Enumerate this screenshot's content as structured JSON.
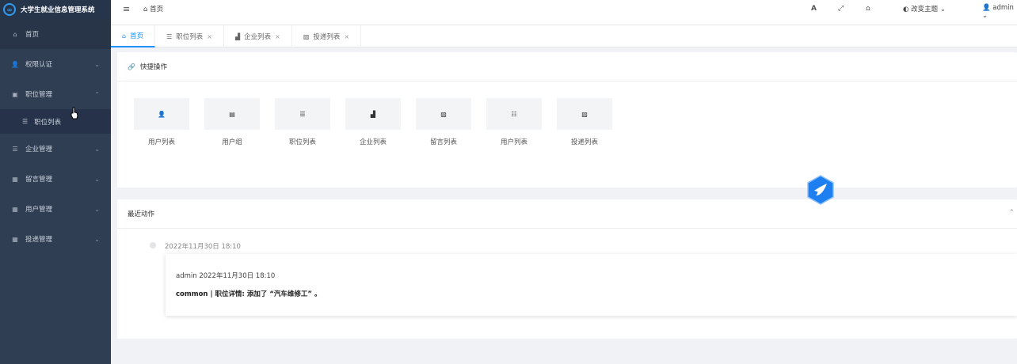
{
  "app": {
    "title": "大学生就业信息管理系统"
  },
  "sidebar": {
    "items": [
      {
        "label": "首页",
        "icon": "home-icon"
      },
      {
        "label": "权限认证",
        "icon": "user-shield-icon"
      },
      {
        "label": "职位管理",
        "icon": "briefcase-icon"
      },
      {
        "label": "企业管理",
        "icon": "list-icon"
      },
      {
        "label": "留言管理",
        "icon": "grid-icon"
      },
      {
        "label": "用户管理",
        "icon": "grid-icon"
      },
      {
        "label": "投递管理",
        "icon": "grid-icon"
      }
    ],
    "submenu": {
      "label": "职位列表",
      "icon": "list-icon"
    }
  },
  "topbar": {
    "breadcrumb": "首页",
    "theme_label": "改变主题",
    "user_label": "admin"
  },
  "tabs": [
    {
      "label": "首页"
    },
    {
      "label": "职位列表"
    },
    {
      "label": "企业列表"
    },
    {
      "label": "投递列表"
    }
  ],
  "quick": {
    "title": "快捷操作",
    "items": [
      {
        "label": "用户列表",
        "icon": "user-icon"
      },
      {
        "label": "用户组",
        "icon": "table-icon"
      },
      {
        "label": "职位列表",
        "icon": "list-icon"
      },
      {
        "label": "企业列表",
        "icon": "factory-icon"
      },
      {
        "label": "留言列表",
        "icon": "image-icon"
      },
      {
        "label": "用户列表",
        "icon": "list-alt-icon"
      },
      {
        "label": "投递列表",
        "icon": "image-icon"
      }
    ]
  },
  "recent": {
    "title": "最近动作",
    "time": "2022年11月30日 18:10",
    "meta": "admin 2022年11月30日 18:10",
    "message": "common | 职位详情: 添加了 “汽车维修工” 。"
  },
  "colors": {
    "sidebar_bg": "#2f3e52",
    "accent": "#1e90ff"
  }
}
